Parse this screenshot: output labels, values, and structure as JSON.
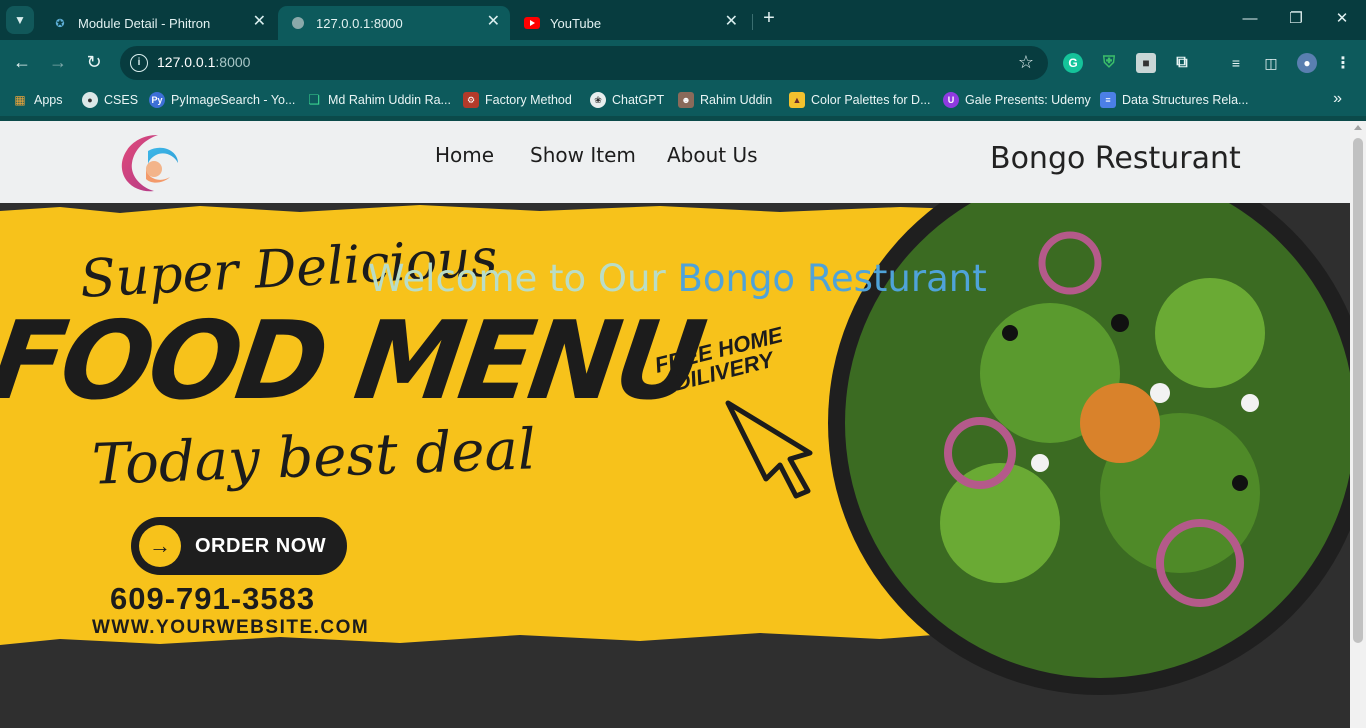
{
  "browser": {
    "tabs": [
      {
        "title": "Module Detail - Phitron",
        "icon": "phitron-icon"
      },
      {
        "title": "127.0.0.1:8000",
        "icon": "globe-icon",
        "active": true
      },
      {
        "title": "YouTube",
        "icon": "youtube-icon"
      }
    ],
    "url_host": "127.0.0.1",
    "url_port": ":8000",
    "bookmarks": [
      {
        "label": "Apps",
        "icon": "apps-grid-icon"
      },
      {
        "label": "CSES",
        "icon": "globe-icon"
      },
      {
        "label": "PyImageSearch - Yo...",
        "icon": "pyimagesearch-icon"
      },
      {
        "label": "Md Rahim Uddin Ra...",
        "icon": "leetcode-icon"
      },
      {
        "label": "Factory Method",
        "icon": "refactoring-icon"
      },
      {
        "label": "ChatGPT",
        "icon": "chatgpt-icon"
      },
      {
        "label": "Rahim Uddin",
        "icon": "profile-icon"
      },
      {
        "label": "Color Palettes for D...",
        "icon": "palette-icon"
      },
      {
        "label": "Gale Presents: Udemy",
        "icon": "udemy-icon"
      },
      {
        "label": "Data Structures Rela...",
        "icon": "docs-icon"
      }
    ]
  },
  "site": {
    "nav": [
      "Home",
      "Show Item",
      "About Us"
    ],
    "brand": "Bongo Resturant",
    "welcome_prefix": "Welcome to Our",
    "welcome_highlight": "Bongo Resturant"
  },
  "banner": {
    "line1": "Super Delicious",
    "line2": "FOOD MENU",
    "line3": "Today best deal",
    "order_label": "ORDER NOW",
    "phone": "609-791-3583",
    "website": "WWW.YOURWEBSITE.COM",
    "delivery_line1": "FREE HOME",
    "delivery_line2": "DILIVERY"
  },
  "colors": {
    "browser_frame": "#0d5a5c",
    "banner_yellow": "#f7c21b",
    "welcome_light": "#b9ddc7",
    "welcome_blue": "#4fa3d9"
  }
}
